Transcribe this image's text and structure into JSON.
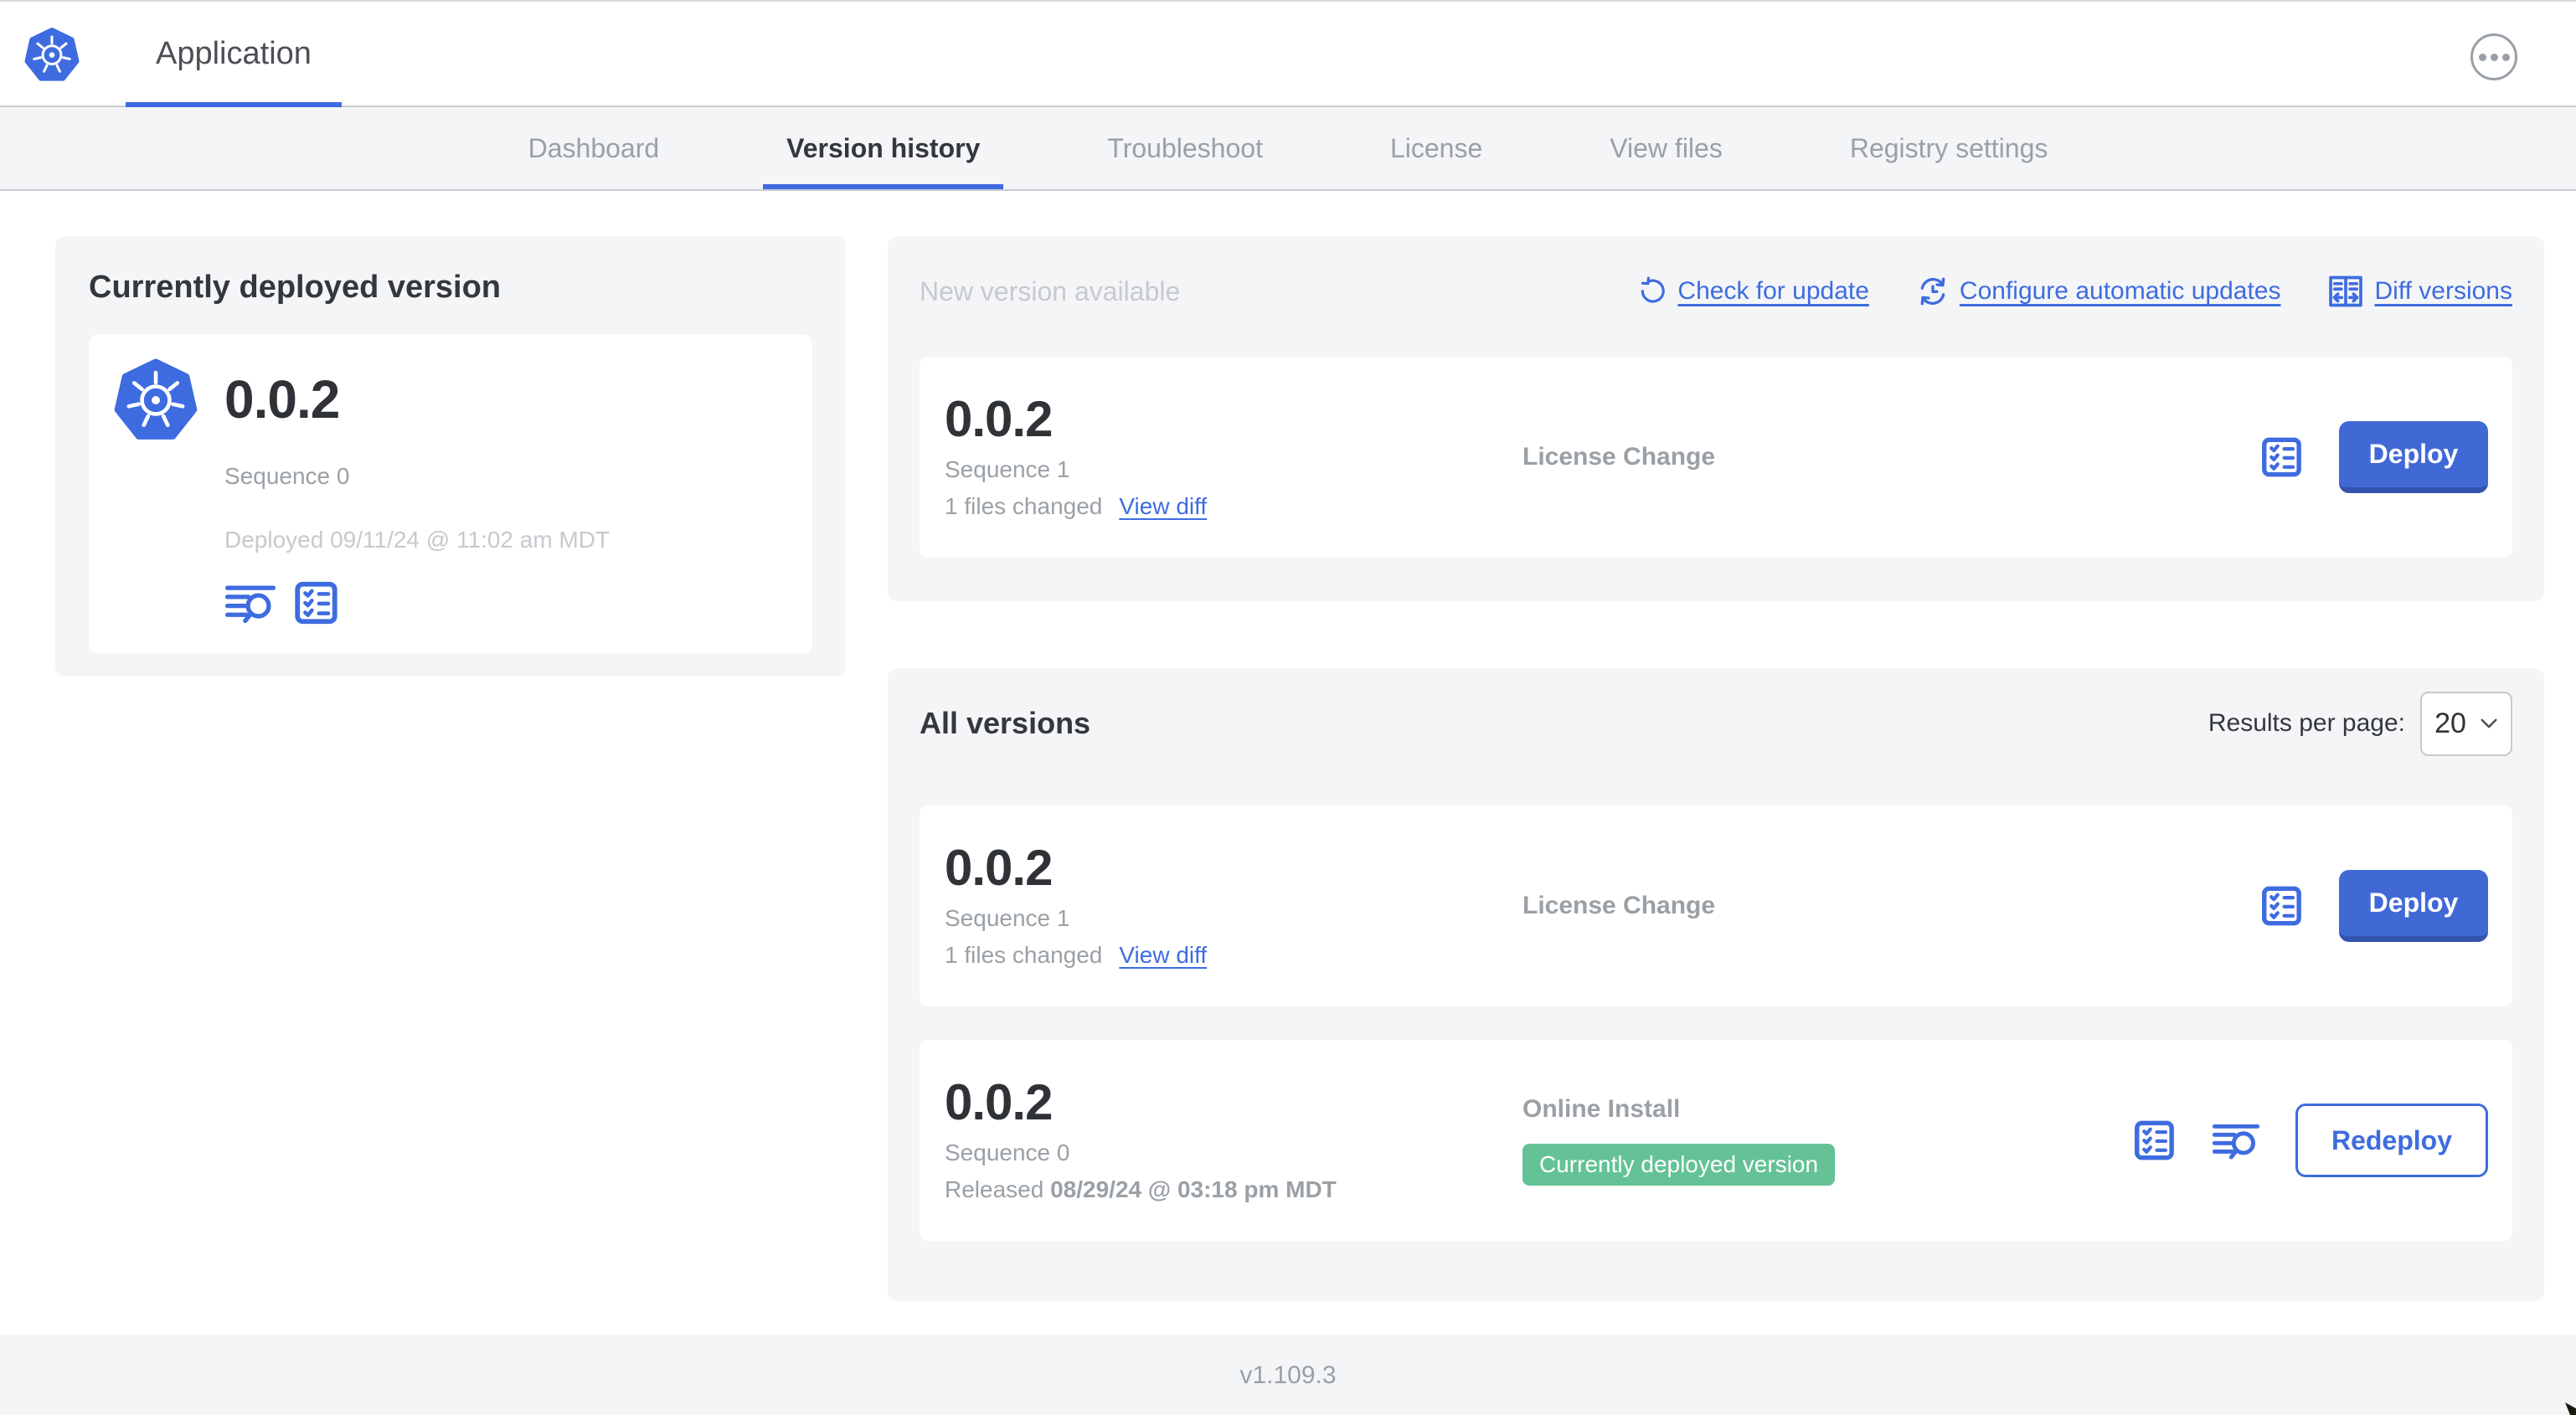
{
  "header": {
    "app_title": "Application"
  },
  "nav": {
    "tabs": [
      {
        "label": "Dashboard"
      },
      {
        "label": "Version history"
      },
      {
        "label": "Troubleshoot"
      },
      {
        "label": "License"
      },
      {
        "label": "View files"
      },
      {
        "label": "Registry settings"
      }
    ]
  },
  "deployed_panel": {
    "title": "Currently deployed version",
    "version": "0.0.2",
    "sequence": "Sequence 0",
    "deployed_at": "Deployed 09/11/24 @ 11:02 am MDT"
  },
  "new_version": {
    "title": "New version available",
    "actions": [
      {
        "label": "Check for update",
        "icon": "refresh-icon"
      },
      {
        "label": "Configure automatic updates",
        "icon": "sync-clock-icon"
      },
      {
        "label": "Diff versions",
        "icon": "diff-icon"
      }
    ],
    "row": {
      "version": "0.0.2",
      "sequence": "Sequence 1",
      "files_changed": "1 files changed",
      "view_diff": "View diff",
      "source": "License Change",
      "action_label": "Deploy"
    }
  },
  "all_versions": {
    "title": "All versions",
    "results_per_page_label": "Results per page:",
    "results_per_page_value": "20",
    "rows": [
      {
        "version": "0.0.2",
        "sequence": "Sequence 1",
        "files_changed": "1 files changed",
        "view_diff": "View diff",
        "source": "License Change",
        "action_label": "Deploy"
      },
      {
        "version": "0.0.2",
        "sequence": "Sequence 0",
        "released_prefix": "Released ",
        "released_date": "08/29/24 @ 03:18 pm MDT",
        "source": "Online Install",
        "badge": "Currently deployed version",
        "action_label": "Redeploy"
      }
    ]
  },
  "footer": {
    "version": "v1.109.3"
  },
  "icons": {
    "app_logo": "kubernetes-wheel",
    "view_logs": "lines-with-magnifier",
    "version_checks": "checklist-box",
    "check_update": "circular-arrow",
    "auto_updates": "sync-arrows-clock",
    "diff_versions": "split-compare-arrows",
    "results_select": "chevron-down",
    "more_options": "ellipsis-in-circle"
  },
  "colors": {
    "accent_blue": "#3e6ce0",
    "button_blue": "#4169d6",
    "badge_green": "#64c296",
    "panel_gray": "#f4f5f7"
  }
}
